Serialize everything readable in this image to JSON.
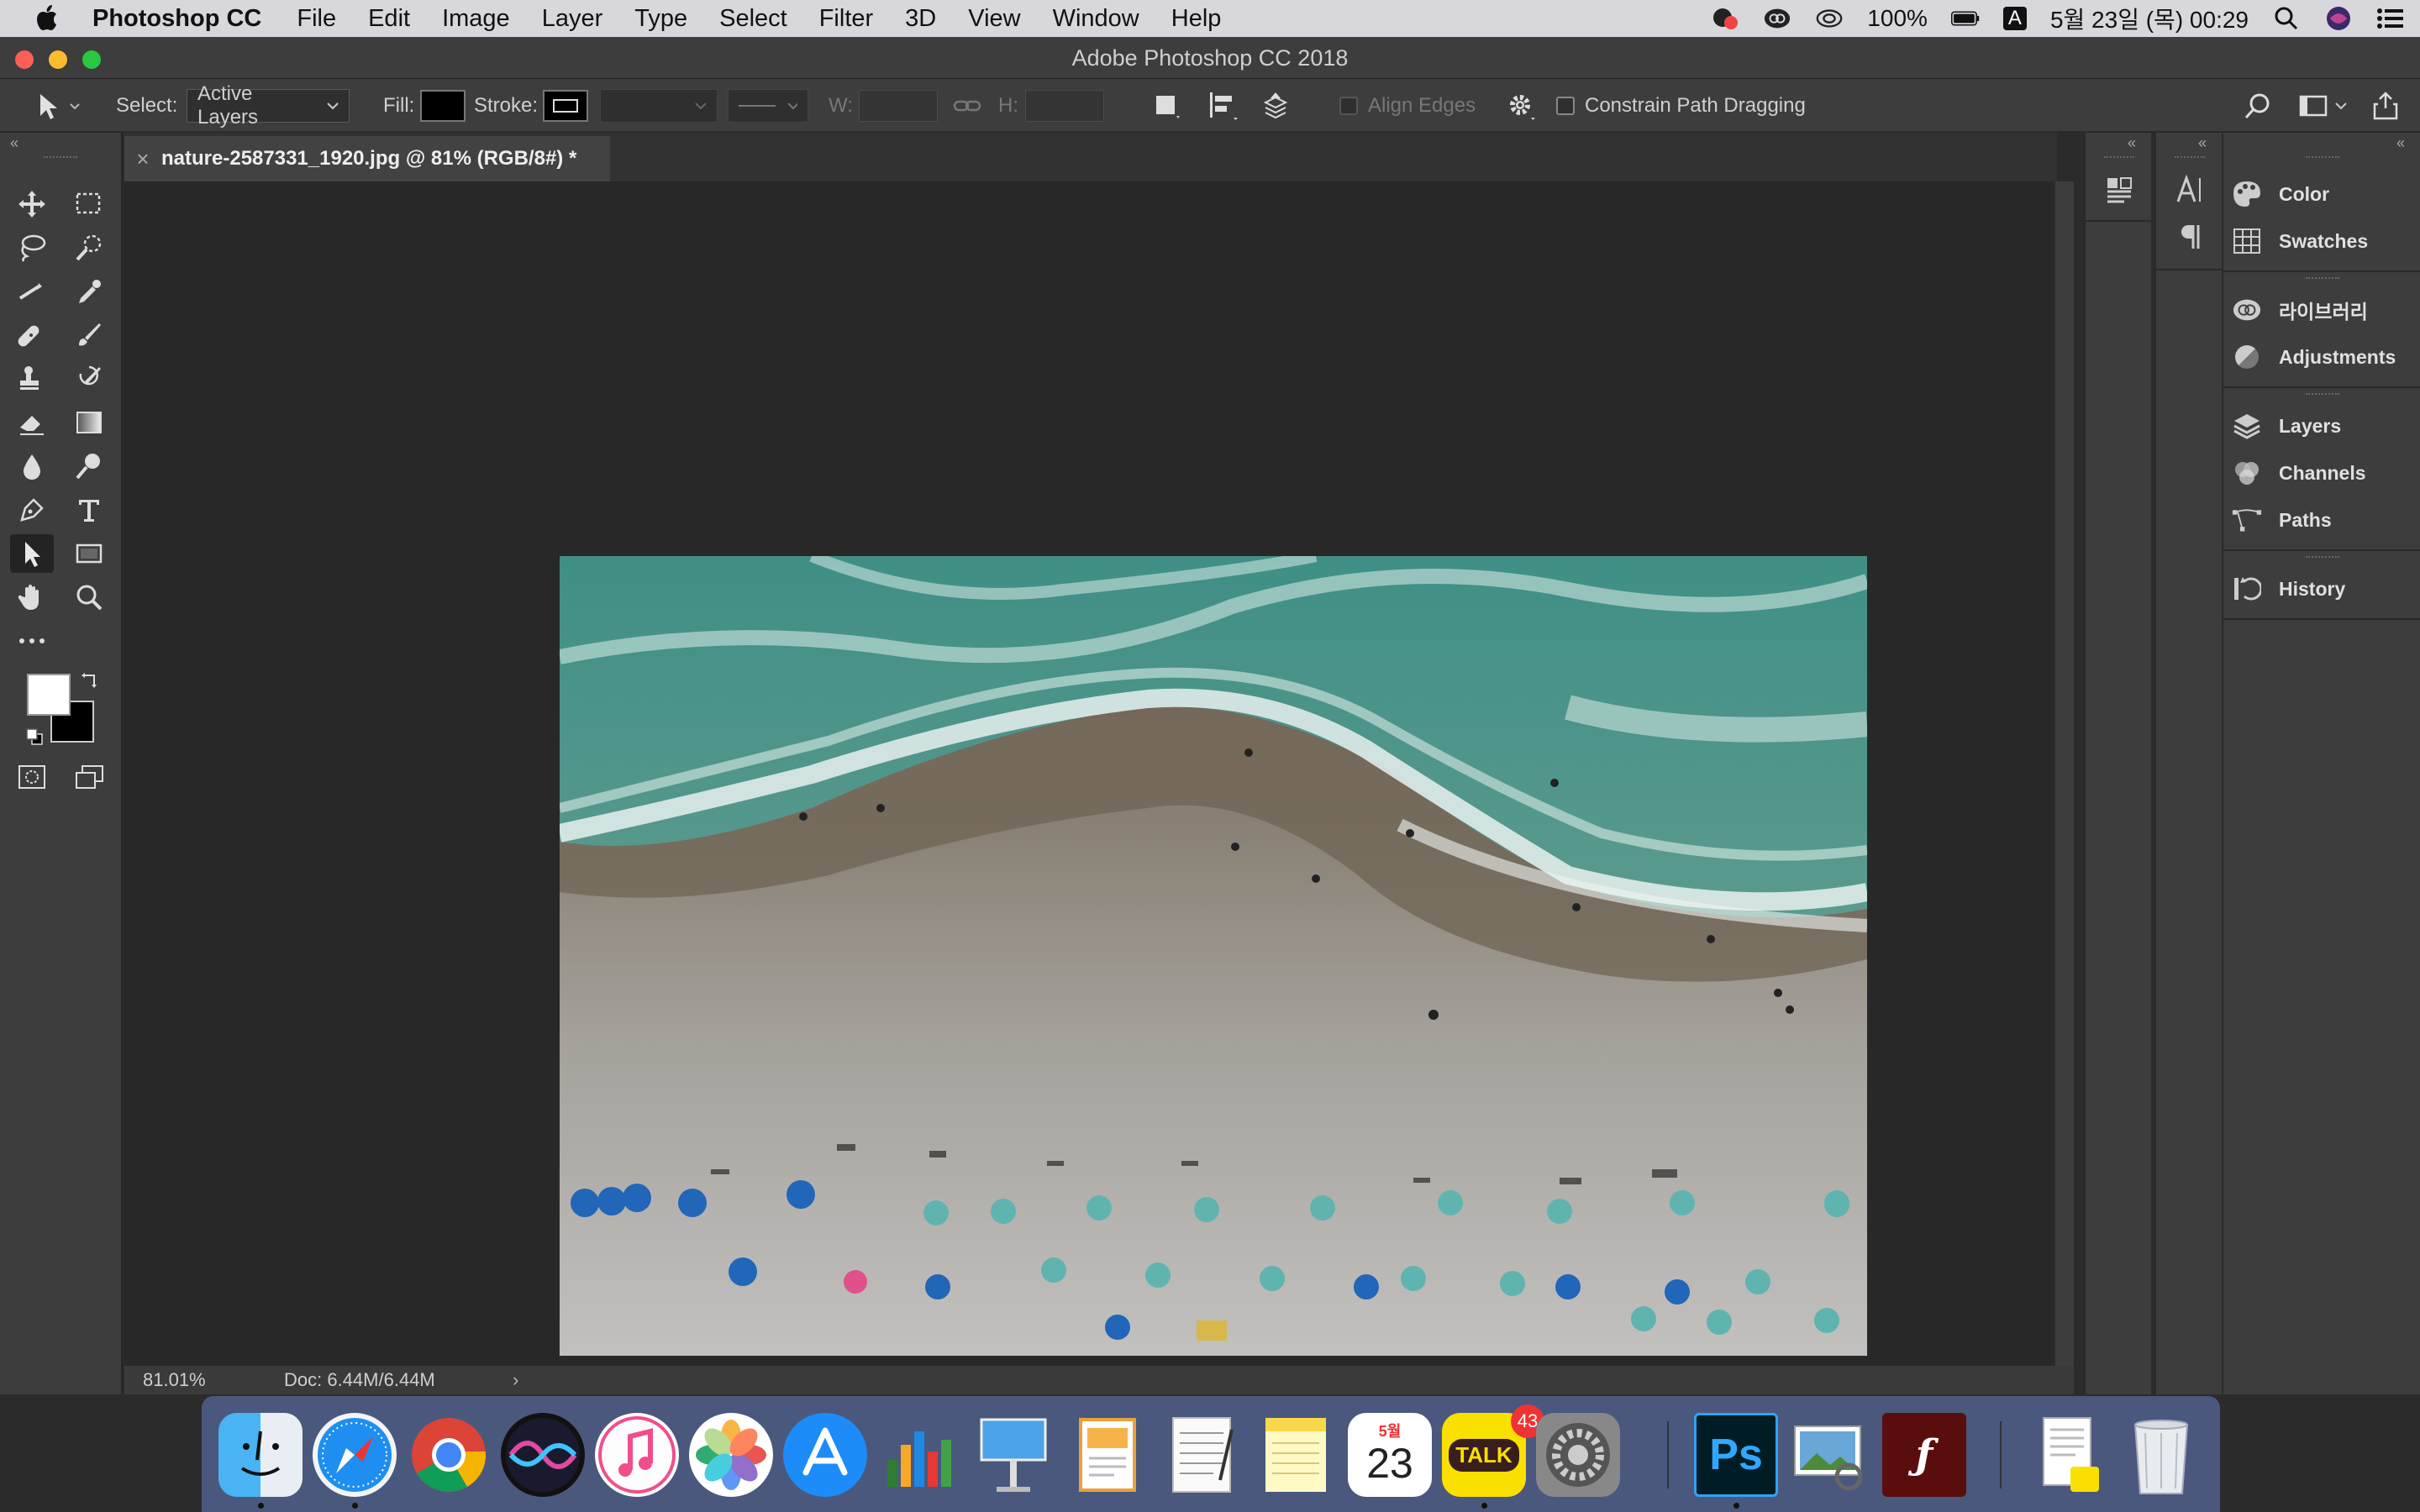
{
  "menubar": {
    "app_name": "Photoshop CC",
    "items": [
      "File",
      "Edit",
      "Image",
      "Layer",
      "Type",
      "Select",
      "Filter",
      "3D",
      "View",
      "Window",
      "Help"
    ],
    "battery": "100%",
    "input_source": "A",
    "datetime": "5월 23일 (목) 00:29"
  },
  "window": {
    "title": "Adobe Photoshop CC 2018"
  },
  "options": {
    "select_label": "Select:",
    "select_value": "Active Layers",
    "fill_label": "Fill:",
    "stroke_label": "Stroke:",
    "w_label": "W:",
    "h_label": "H:",
    "align_edges": "Align Edges",
    "constrain": "Constrain Path Dragging"
  },
  "document": {
    "tab_title": "nature-2587331_1920.jpg @ 81% (RGB/8#) *",
    "zoom": "81.01%",
    "doc_size": "Doc: 6.44M/6.44M"
  },
  "panels": {
    "items": [
      {
        "label": "Color",
        "icon": "color-icon"
      },
      {
        "label": "Swatches",
        "icon": "swatches-icon"
      },
      {
        "label": "라이브러리",
        "icon": "libraries-icon"
      },
      {
        "label": "Adjustments",
        "icon": "adjustments-icon"
      },
      {
        "label": "Layers",
        "icon": "layers-icon"
      },
      {
        "label": "Channels",
        "icon": "channels-icon"
      },
      {
        "label": "Paths",
        "icon": "paths-icon"
      },
      {
        "label": "History",
        "icon": "history-icon"
      }
    ]
  },
  "dock": {
    "calendar_month": "5월",
    "calendar_day": "23",
    "talk_label": "TALK",
    "talk_badge": "43",
    "ps_label": "Ps"
  },
  "colors": {
    "accent": "#2f7de1",
    "foreground_swatch": "#ffffff",
    "background_swatch": "#000000"
  }
}
